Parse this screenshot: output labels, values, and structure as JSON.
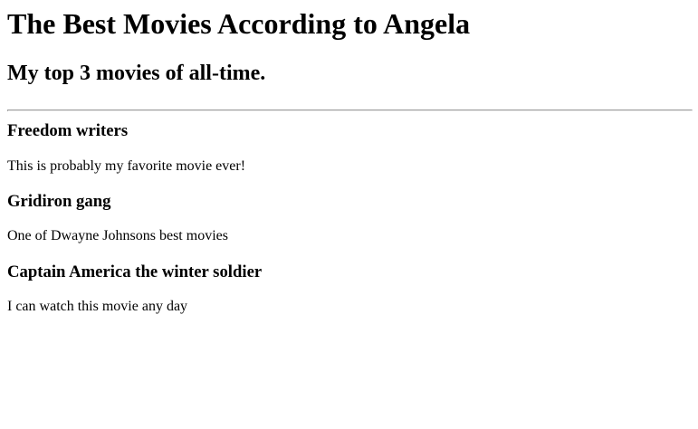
{
  "header": {
    "title": "The Best Movies According to Angela",
    "subtitle": "My top 3 movies of all-time."
  },
  "movies": [
    {
      "title": "Freedom writers",
      "description": "This is probably my favorite movie ever!"
    },
    {
      "title": "Gridiron gang",
      "description": "One of Dwayne Johnsons best movies"
    },
    {
      "title": "Captain America the winter soldier",
      "description": "I can watch this movie any day"
    }
  ],
  "colors": {
    "text": "#000000",
    "background": "#ffffff",
    "divider": "#9a9a9a"
  }
}
